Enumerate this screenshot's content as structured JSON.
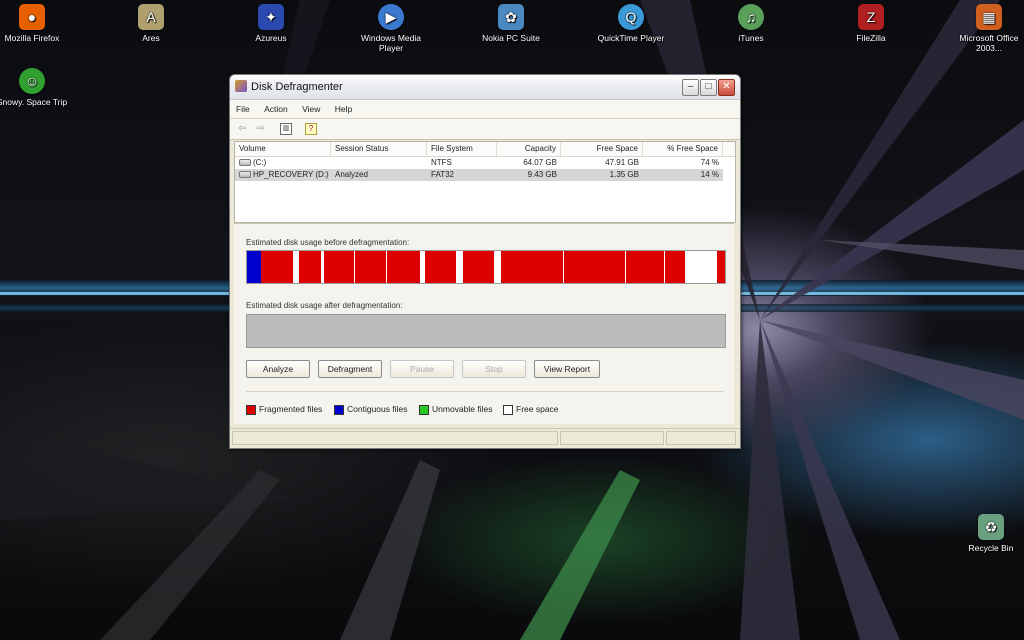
{
  "desktop": {
    "icons": [
      {
        "label": "Mozilla Firefox",
        "icon": "firefox-icon",
        "color": "#e66000"
      },
      {
        "label": "Ares",
        "icon": "ares-icon",
        "color": "#b0a070"
      },
      {
        "label": "Azureus",
        "icon": "azureus-icon",
        "color": "#2a4ab0"
      },
      {
        "label": "Windows Media Player",
        "icon": "media-player-icon",
        "color": "#3a7ad0"
      },
      {
        "label": "Nokia PC Suite",
        "icon": "nokia-icon",
        "color": "#4a8ac0"
      },
      {
        "label": "QuickTime Player",
        "icon": "quicktime-icon",
        "color": "#3a9ad8"
      },
      {
        "label": "iTunes",
        "icon": "itunes-icon",
        "color": "#5aa05a"
      },
      {
        "label": "FileZilla",
        "icon": "filezilla-icon",
        "color": "#b02020"
      },
      {
        "label": "Microsoft Office 2003...",
        "icon": "office-icon",
        "color": "#d06020"
      },
      {
        "label": "Snowy. Space Trip",
        "icon": "snowy-icon",
        "color": "#30a030"
      },
      {
        "label": "Recycle Bin",
        "icon": "recycle-bin-icon",
        "color": "#6aa080"
      }
    ]
  },
  "window": {
    "title": "Disk Defragmenter",
    "menu": [
      "File",
      "Action",
      "View",
      "Help"
    ],
    "columns": [
      "Volume",
      "Session Status",
      "File System",
      "Capacity",
      "Free Space",
      "% Free Space"
    ],
    "volumes": [
      {
        "volume": "(C:)",
        "status": "",
        "fs": "NTFS",
        "capacity": "64.07 GB",
        "free": "47.91 GB",
        "pct": "74 %"
      },
      {
        "volume": "HP_RECOVERY (D:)",
        "status": "Analyzed",
        "fs": "FAT32",
        "capacity": "9.43 GB",
        "free": "1.35 GB",
        "pct": "14 %"
      }
    ],
    "before_label": "Estimated disk usage before defragmentation:",
    "after_label": "Estimated disk usage after defragmentation:",
    "buttons": {
      "analyze": "Analyze",
      "defragment": "Defragment",
      "pause": "Pause",
      "stop": "Stop",
      "report": "View Report"
    },
    "legend": {
      "fragmented": "Fragmented files",
      "contiguous": "Contiguous files",
      "unmovable": "Unmovable files",
      "free": "Free space"
    },
    "colors": {
      "fragmented": "#dd0000",
      "contiguous": "#0000cc",
      "unmovable": "#22cc22",
      "free": "#ffffff"
    }
  }
}
